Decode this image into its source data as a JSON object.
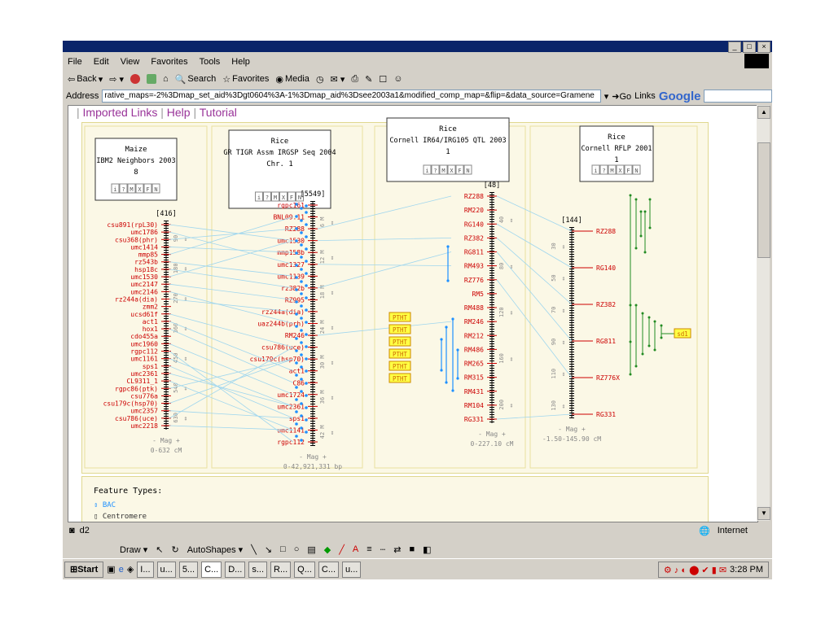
{
  "window": {
    "title": ""
  },
  "menu": [
    "File",
    "Edit",
    "View",
    "Favorites",
    "Tools",
    "Help"
  ],
  "toolbar": {
    "back": "Back",
    "search": "Search",
    "favorites": "Favorites",
    "media": "Media"
  },
  "address": {
    "label": "Address",
    "url": "rative_maps=-2%3Dmap_set_aid%3Dgt0604%3A-1%3Dmap_aid%3Dsee2003a1&modified_comp_map=&flip=&data_source=Gramene",
    "go": "Go",
    "links": "Links",
    "google": "Google"
  },
  "page": {
    "links": [
      "Imported Links",
      "Help",
      "Tutorial"
    ]
  },
  "maps": [
    {
      "species": "Maize",
      "set": "IBM2 Neighbors 2003",
      "map": "8",
      "count": "[416]",
      "range": "0-632 cM",
      "mag": "- Mag +",
      "ticks": [
        "90",
        "180",
        "270",
        "360",
        "450",
        "540",
        "630"
      ],
      "features": [
        "csu891(rpL30)",
        "umc1786",
        "csu368(phr)",
        "umc1414",
        "mmp85",
        "rz543b",
        "hsp18c",
        "umc1530",
        "umc2147",
        "umc2146",
        "rz244a(dia)",
        "zmm2",
        "ucsd61f",
        "act1",
        "hox1",
        "cdo455a",
        "umc1960",
        "rgpc112",
        "umc1161",
        "sps1",
        "umc2361",
        "CL9311_1",
        "rgpc86(ptk)",
        "csu776a",
        "csu179c(hsp70)",
        "umc2357",
        "csu786(uce)",
        "umc2218"
      ]
    },
    {
      "species": "Rice",
      "set": "GR TIGR Assm IRGSP Seq 2004",
      "map": "Chr. 1",
      "count": "[5549]",
      "range": "0-42,921,331 bp",
      "mag": "- Mag +",
      "ticks": [
        "6 M",
        "12 M",
        "18 M",
        "24 M",
        "30 M",
        "36 M",
        "42 M"
      ],
      "features": [
        "rgpc161",
        "BNL09.11",
        "RZ288",
        "umc1530",
        "mmp158b",
        "umc1327",
        "umc1139",
        "rz382b",
        "RZ995",
        "rz244a(dia)",
        "uaz244b(prh)",
        "RM246",
        "csu786(uce)",
        "csu179c(hsp70)",
        "act1",
        "C86",
        "umc1724",
        "umc2361",
        "sps1",
        "umc1141",
        "rgpc112"
      ]
    },
    {
      "species": "Rice",
      "set": "Cornell IR64/IRG105 QTL 2003",
      "map": "1",
      "count": "[48]",
      "range": "0-227.10 cM",
      "mag": "- Mag +",
      "ticks": [
        "40",
        "80",
        "120",
        "160",
        "200"
      ],
      "features": [
        "RZ288",
        "RM220",
        "RG140",
        "RZ382",
        "RG811",
        "RM493",
        "RZ776",
        "RM5",
        "RM488",
        "RM246",
        "RM212",
        "RM486",
        "RM265",
        "RM315",
        "RM431",
        "RM104",
        "RG331"
      ],
      "qtl": [
        "PTHT",
        "PTHT",
        "PTHT",
        "PTHT",
        "PTHT",
        "PTHT"
      ]
    },
    {
      "species": "Rice",
      "set": "Cornell RFLP 2001",
      "map": "1",
      "count": "[144]",
      "range": "-1.50-145.90 cM",
      "mag": "- Mag +",
      "ticks": [
        "30",
        "50",
        "70",
        "90",
        "110",
        "130"
      ],
      "features": [
        "RZ288",
        "RG140",
        "RZ382",
        "RG811",
        "RZ776X",
        "RG331"
      ],
      "qtl_label": "sd1"
    }
  ],
  "map_buttons": [
    "i",
    "?",
    "M",
    "X",
    "F",
    "N"
  ],
  "legend": {
    "title": "Feature Types:",
    "items": [
      "BAC",
      "Centromere"
    ]
  },
  "status": {
    "text": "d2",
    "zone": "Internet"
  },
  "drawbar": {
    "draw": "Draw",
    "autoshapes": "AutoShapes"
  },
  "taskbar": {
    "start": "Start",
    "tasks": [
      "I...",
      "u...",
      "5...",
      "C...",
      "D...",
      "s...",
      "R...",
      "Q...",
      "C...",
      "u..."
    ],
    "time": "3:28 PM"
  },
  "colors": {
    "feature": "#cc0000",
    "link": "#9fd6ee",
    "qtl": "#228b22",
    "bac": "#1e90ff",
    "panel": "#fbf8e6"
  }
}
